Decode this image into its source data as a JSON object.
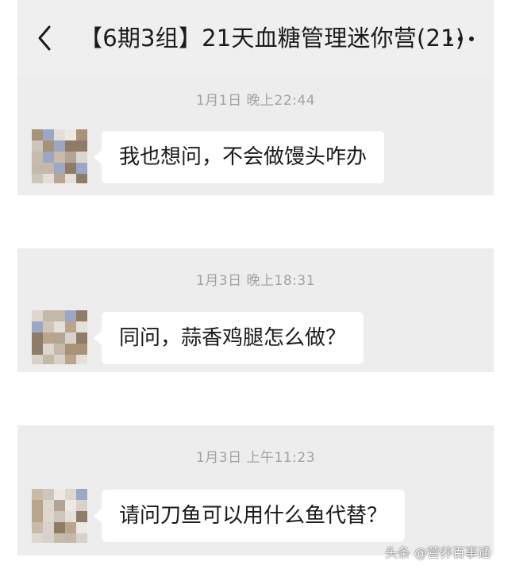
{
  "header": {
    "back_icon": "chevron-left-icon",
    "title": "【6期3组】21天血糖管理迷你营(21)",
    "more_icon": "more-horizontal-icon"
  },
  "messages": [
    {
      "timestamp": "1月1日 晚上22:44",
      "text": "我也想问，不会做馒头咋办"
    },
    {
      "timestamp": "1月3日 晚上18:31",
      "text": "同问，蒜香鸡腿怎么做？"
    },
    {
      "timestamp": "1月3日 上午11:23",
      "text": "请问刀鱼可以用什么鱼代替？"
    }
  ],
  "watermark": {
    "text": "头条 @营养百事通"
  },
  "colors": {
    "chat_background": "#ededed",
    "bubble_background": "#ffffff",
    "timestamp_text": "#a2a2a2",
    "message_text": "#1a1a1a"
  }
}
